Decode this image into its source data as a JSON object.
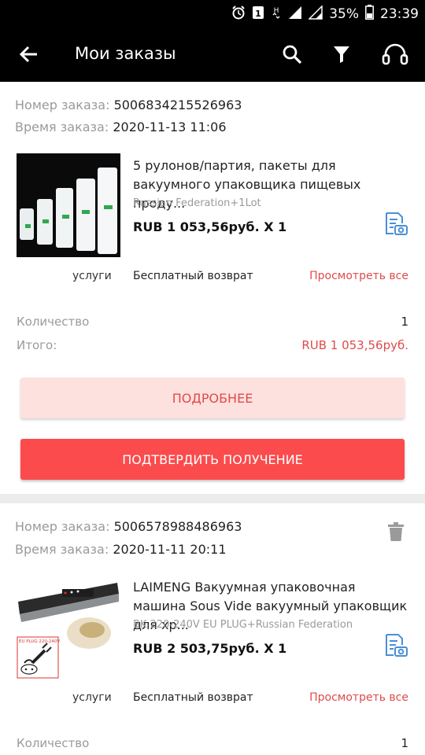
{
  "status_bar": {
    "battery": "35%",
    "time": "23:39"
  },
  "header": {
    "title": "Мои заказы"
  },
  "orders": [
    {
      "order_no_label": "Номер заказа:",
      "order_no": "5006834215526963",
      "time_label": "Время заказа:",
      "time": "2020-11-13 11:06",
      "product_title": "5 рулонов/партия, пакеты для вакуумного упаковщика пищевых проду...",
      "variant": "Russian Federation+1Lot",
      "price": "RUB 1 053,56руб. X 1",
      "services_label": "услуги",
      "services_value": "Бесплатный возврат",
      "view_all": "Просмотреть все",
      "qty_label": "Количество",
      "qty": "1",
      "total_label": "Итого:",
      "total": "RUB 1 053,56руб.",
      "details_button": "ПОДРОБНЕЕ",
      "confirm_button": "ПОДТВЕРДИТЬ ПОЛУЧЕНИЕ"
    },
    {
      "order_no_label": "Номер заказа:",
      "order_no": "5006578988486963",
      "time_label": "Время заказа:",
      "time": "2020-11-11 20:11",
      "product_title": "LAIMENG Вакуумная упаковочная машина Sous Vide вакуумный упаковщик для хр...",
      "variant": "BK 220-240V EU PLUG+Russian Federation",
      "price": "RUB 2 503,75руб. X 1",
      "thumb_plug_label": "EU PLUG  220-240V",
      "services_label": "услуги",
      "services_value": "Бесплатный возврат",
      "view_all": "Просмотреть все",
      "qty_label": "Количество",
      "qty": "1"
    }
  ],
  "icons": {
    "back": "arrow-left-icon",
    "search": "search-icon",
    "filter": "filter-icon",
    "support": "headset-icon",
    "review": "photo-review-icon",
    "delete": "trash-icon"
  },
  "colors": {
    "accent": "#fb4b4c",
    "accent_light": "#fde1de",
    "link": "#e04a4a"
  }
}
